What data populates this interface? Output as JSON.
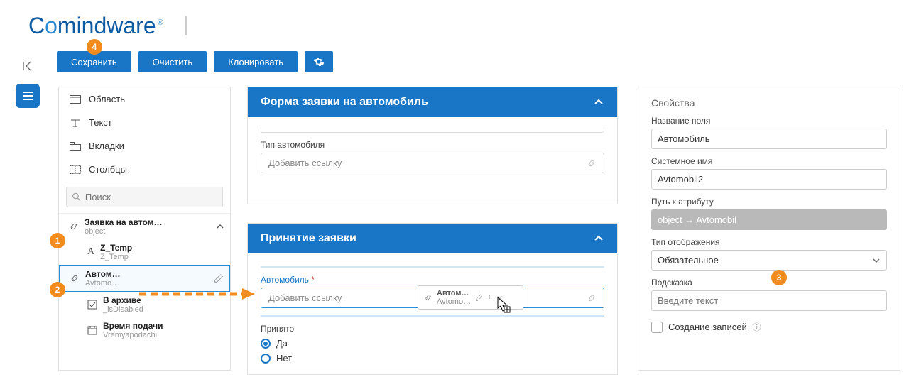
{
  "brand": {
    "part1": "C",
    "part2": "o",
    "part3": "mindware"
  },
  "toolbar": {
    "save": "Сохранить",
    "clear": "Очистить",
    "clone": "Клонировать"
  },
  "left": {
    "items": {
      "area": "Область",
      "text": "Текст",
      "tabs": "Вкладки",
      "columns": "Столбцы"
    },
    "search_placeholder": "Поиск",
    "tree": {
      "root_label": "Заявка на автом…",
      "root_sub": "object",
      "c1_label": "Z_Temp",
      "c1_sub": "Z_Temp",
      "c2_label": "Автом…",
      "c2_sub": "Avtomo…",
      "c3_label": "В архиве",
      "c3_sub": "_isDisabled",
      "c4_label": "Время подачи",
      "c4_sub": "Vremyapodachi"
    }
  },
  "mid1": {
    "title": "Форма заявки на автомобиль",
    "field_label": "Тип автомобиля",
    "placeholder": "Добавить ссылку"
  },
  "mid2": {
    "title": "Принятие заявки",
    "field_label": "Автомобиль",
    "req": "*",
    "placeholder": "Добавить ссылку",
    "accepted_label": "Принято",
    "yes": "Да",
    "no": "Нет"
  },
  "drag": {
    "label": "Автом…",
    "sub": "Avtomo…"
  },
  "right": {
    "title": "Свойства",
    "name_label": "Название поля",
    "name_val": "Автомобиль",
    "sys_label": "Системное имя",
    "sys_val": "Avtomobil2",
    "path_label": "Путь к атрибуту",
    "path_val": "object → Avtomobil",
    "disp_label": "Тип отображения",
    "disp_val": "Обязательное",
    "hint_label": "Подсказка",
    "hint_placeholder": "Введите текст",
    "create_label": "Создание записей"
  },
  "badges": {
    "b1": "1",
    "b2": "2",
    "b3": "3",
    "b4": "4"
  }
}
